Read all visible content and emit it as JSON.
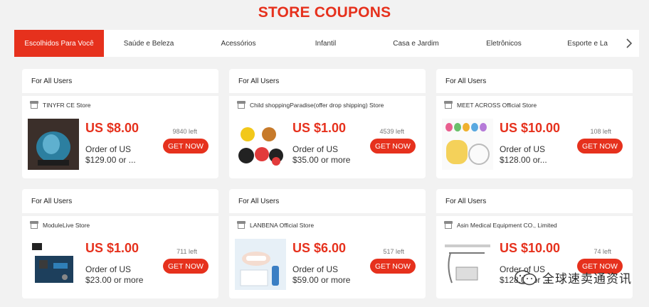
{
  "title": "STORE COUPONS",
  "tabs": [
    {
      "label": "Escolhidos Para Você",
      "active": true
    },
    {
      "label": "Saúde e Beleza"
    },
    {
      "label": "Acessórios"
    },
    {
      "label": "Infantil"
    },
    {
      "label": "Casa e Jardim"
    },
    {
      "label": "Eletrônicos"
    },
    {
      "label": "Esporte e La"
    }
  ],
  "next_icon": "chevron-right-icon",
  "coupons": [
    {
      "audience": "For All Users",
      "store": "TINYFR CE Store",
      "amount": "US $8.00",
      "condition": "Order of US $129.00 or ...",
      "remaining": "9840 left",
      "button": "GET NOW"
    },
    {
      "audience": "For All Users",
      "store": "Child shoppingParadise(offer drop shipping) Store",
      "amount": "US $1.00",
      "condition": "Order of US $35.00 or more",
      "remaining": "4539 left",
      "button": "GET NOW"
    },
    {
      "audience": "For All Users",
      "store": "MEET ACROSS Official Store",
      "amount": "US $10.00",
      "condition": "Order of US $128.00 or...",
      "remaining": "108 left",
      "button": "GET NOW"
    },
    {
      "audience": "For All Users",
      "store": "ModuleLive Store",
      "amount": "US $1.00",
      "condition": "Order of US $23.00 or more",
      "remaining": "711 left",
      "button": "GET NOW"
    },
    {
      "audience": "For All Users",
      "store": "LANBENA Official Store",
      "amount": "US $6.00",
      "condition": "Order of US $59.00 or more",
      "remaining": "517 left",
      "button": "GET NOW"
    },
    {
      "audience": "For All Users",
      "store": "Asin Medical Equipment CO., Limited",
      "amount": "US $10.00",
      "condition": "Order of US $128.00 or ...",
      "remaining": "74 left",
      "button": "GET NOW"
    }
  ],
  "watermark": "全球速卖通资讯",
  "colors": {
    "accent": "#e6311d",
    "background": "#f2f2f2"
  }
}
